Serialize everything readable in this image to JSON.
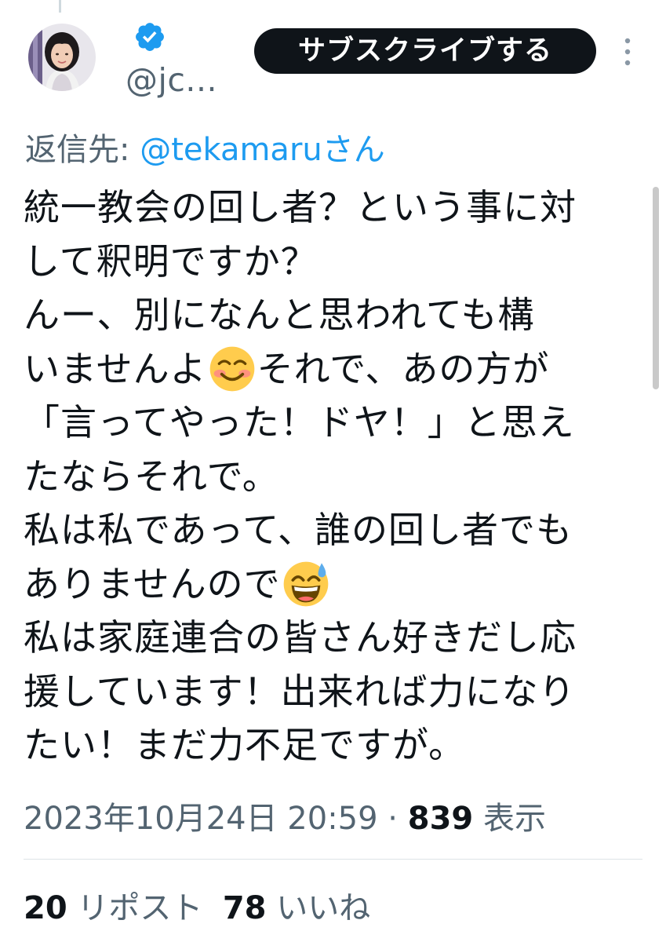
{
  "author": {
    "handle": "@jc...",
    "verified": true,
    "avatar_icon": "user-avatar-photo"
  },
  "header": {
    "subscribe_label": "サブスクライブする",
    "more_icon": "more-vertical-icon"
  },
  "reply": {
    "prefix": "返信先: ",
    "mention": "@tekamaru",
    "suffix": "さん"
  },
  "tweet": {
    "lines": [
      "統一教会の回し者？という事に対",
      "して釈明ですか？",
      "んー、別になんと思われても構",
      "いませんよ",
      "それで、あの方が",
      "「言ってやった！ドヤ！」と思え",
      "たならそれで。",
      "私は私であって、誰の回し者でも",
      "ありませんので",
      "私は家庭連合の皆さん好きだし応",
      "援しています！出来れば力になり",
      "たい！まだ力不足ですが。"
    ],
    "emojis": [
      "smiling-face-icon",
      "grinning-sweat-face-icon"
    ]
  },
  "meta": {
    "timestamp": "2023年10月24日 20:59",
    "separator": " · ",
    "views_count": "839",
    "views_label": " 表示"
  },
  "stats": {
    "reposts_count": "20",
    "reposts_label": " リポスト",
    "likes_count": "78",
    "likes_label": " いいね"
  },
  "colors": {
    "text_primary": "#0f1419",
    "text_secondary": "#536471",
    "link": "#1d9bf0",
    "verified_badge": "#1d9bf0",
    "button_bg": "#0f1419"
  }
}
